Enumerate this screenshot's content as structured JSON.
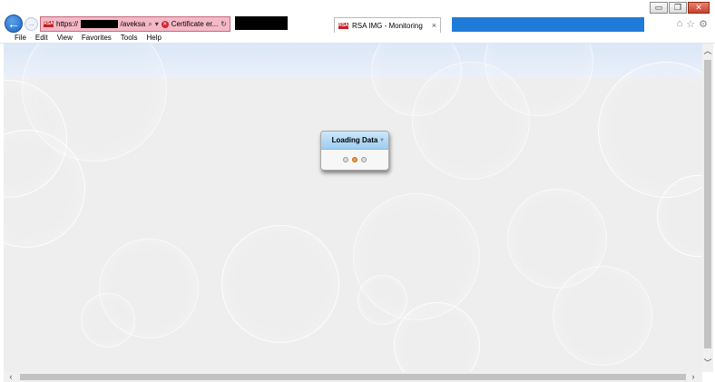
{
  "window": {
    "controls": {
      "minimize": "▭",
      "restore": "❐",
      "close": "✕"
    }
  },
  "address": {
    "prefix": "https://",
    "suffix": "/aveksa",
    "search_icon": "search-icon",
    "dropdown": "▾",
    "certificate": "Certificate er...",
    "refresh": "↻"
  },
  "tab": {
    "title": "RSA IMG - Monitoring",
    "close": "×",
    "favicon": "RSA"
  },
  "menu": [
    "File",
    "Edit",
    "View",
    "Favorites",
    "Tools",
    "Help"
  ],
  "loading": {
    "title": "Loading Data"
  },
  "colors": {
    "accent": "#1e7bd8",
    "address_bg": "#f5b8c6",
    "loading_dot": "#f39a3d"
  }
}
